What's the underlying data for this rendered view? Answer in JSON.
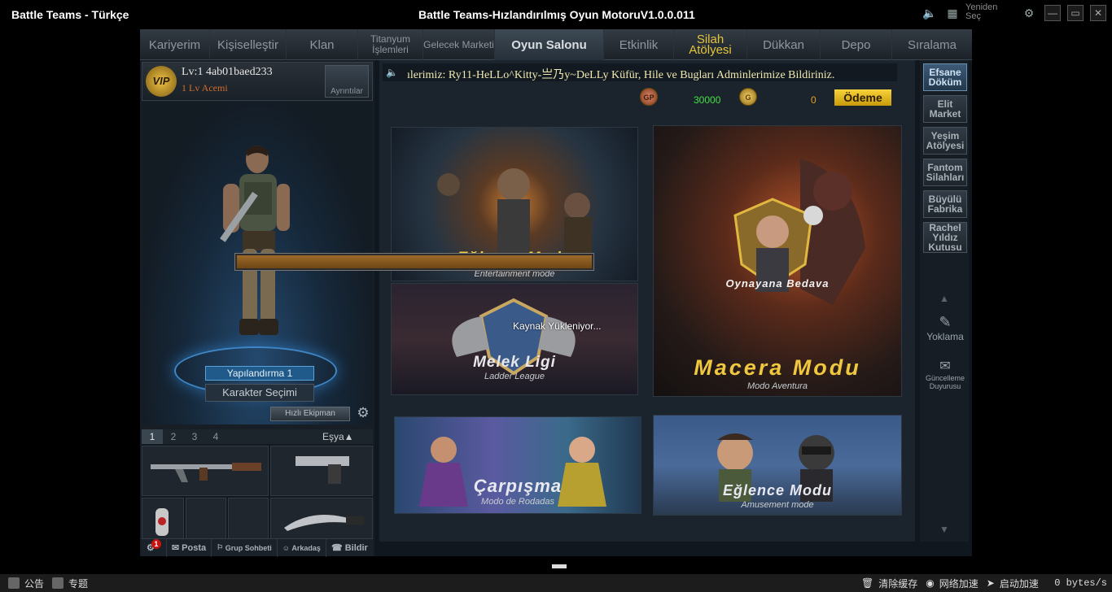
{
  "titlebar": {
    "app_title": "Battle Teams - Türkçe",
    "window_title": "Battle Teams-Hızlandırılmış Oyun MotoruV1.0.0.011",
    "reselect_label": "Yeniden Seç",
    "icons": [
      "speaker-icon",
      "grid-icon",
      "settings-icon",
      "minimize-icon",
      "restore-icon",
      "close-icon"
    ]
  },
  "tabs": [
    {
      "label": "Kariyerim"
    },
    {
      "label": "Kişiselleştir"
    },
    {
      "label": "Klan"
    },
    {
      "label": "Titanyum İşlemleri"
    },
    {
      "label": "Gelecek Marketi"
    },
    {
      "label": "Oyun Salonu",
      "active": true
    },
    {
      "label": "Etkinlik"
    },
    {
      "label": "Silah Atölyesi"
    },
    {
      "label": "Dükkan"
    },
    {
      "label": "Depo"
    },
    {
      "label": "Sıralama"
    }
  ],
  "profile": {
    "vip_label": "VIP",
    "name": "Lv:1 4ab01baed233",
    "rank": "1 Lv Acemi",
    "detail_label": "Ayrıntılar"
  },
  "character": {
    "config_label": "Yapılandırma 1",
    "select_label": "Karakter Seçimi",
    "quick_equip_label": "Hızlı Ekipman"
  },
  "loadout": {
    "tabs": [
      "1",
      "2",
      "3",
      "4"
    ],
    "items_label": "Eşya▲"
  },
  "bottombar": {
    "notification_count": "1",
    "mail_label": "Posta",
    "group_chat_label": "Grup Sohbeti",
    "friends_label": "Arkadaş",
    "report_label": "Bildir"
  },
  "ticker": {
    "text": "ılerimiz: Ry11-HeLLo^Kitty-亗乃y~DeLLy Küfür, Hile ve Bugları Adminlerimize Bildiriniz."
  },
  "currency": {
    "gp_label": "GP",
    "gp_amount": "30000",
    "gold_label": "G",
    "gold_amount": "0",
    "pay_label": "Ödeme"
  },
  "modes": {
    "entertainment_title": "Eğlence Modu",
    "entertainment_sub": "Entertainment mode",
    "free_title": "Oynayana Bedava",
    "ladder_title": "Melek Ligi",
    "ladder_sub": "Ladder League",
    "adventure_title": "Macera Modu",
    "adventure_sub": "Modo Aventura",
    "clash_title": "Çarpışma",
    "clash_sub": "Modo de Rodadas",
    "amusement_title": "Eğlence Modu",
    "amusement_sub": "Amusement mode"
  },
  "loading": {
    "text": "Kaynak Yükleniyor..."
  },
  "sidebar": {
    "items": [
      {
        "label": "Efsane Döküm",
        "active": true
      },
      {
        "label": "Elit Market"
      },
      {
        "label": "Yeşim Atölyesi"
      },
      {
        "label": "Fantom Silahları"
      },
      {
        "label": "Büyülü Fabrika"
      },
      {
        "label": "Rachel Yıldız Kutusu"
      }
    ],
    "attendance_label": "Yoklama",
    "update_label": "Güncelleme Duyurusu"
  },
  "taskbar": {
    "announcement_label": "公告",
    "topic_label": "专题",
    "clear_cache_label": "清除缓存",
    "network_accel_label": "网络加速",
    "boot_accel_label": "启动加速",
    "speed": "0 bytes/s"
  },
  "colors": {
    "accent_yellow": "#e4c53a",
    "active_tab": "#3d4954",
    "gp_green": "#44e044"
  }
}
